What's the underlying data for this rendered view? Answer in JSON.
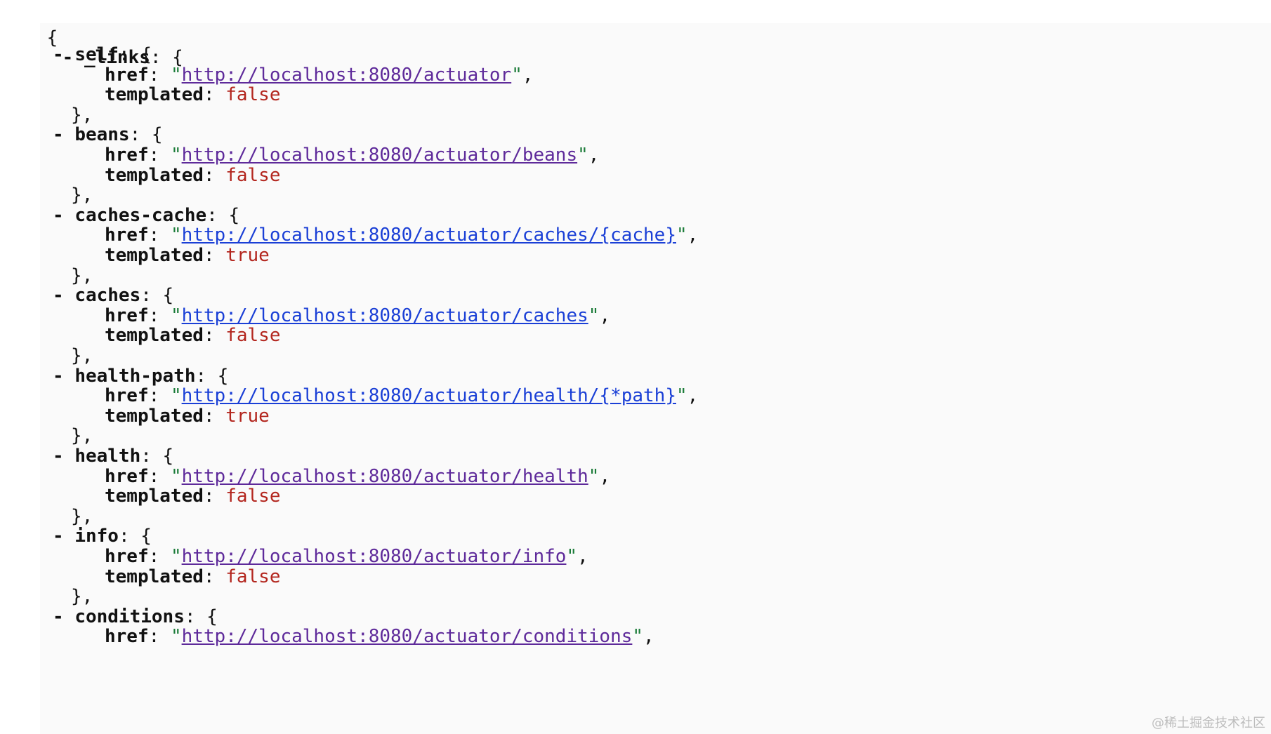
{
  "json_view": {
    "open_brace": "{",
    "root_collapse": "-",
    "root_key": "_links",
    "entries": [
      {
        "name": "self",
        "href": "http://localhost:8080/actuator",
        "templated": "false"
      },
      {
        "name": "beans",
        "href": "http://localhost:8080/actuator/beans",
        "templated": "false"
      },
      {
        "name": "caches-cache",
        "href": "http://localhost:8080/actuator/caches/{cache}",
        "templated": "true"
      },
      {
        "name": "caches",
        "href": "http://localhost:8080/actuator/caches",
        "templated": "false"
      },
      {
        "name": "health-path",
        "href": "http://localhost:8080/actuator/health/{*path}",
        "templated": "true"
      },
      {
        "name": "health",
        "href": "http://localhost:8080/actuator/health",
        "templated": "false"
      },
      {
        "name": "info",
        "href": "http://localhost:8080/actuator/info",
        "templated": "false"
      },
      {
        "name": "conditions",
        "href": "http://localhost:8080/actuator/conditions",
        "templated": ""
      }
    ],
    "labels": {
      "collapse": "-",
      "href": "href",
      "templated": "templated",
      "close": "},"
    }
  },
  "colors": {
    "visited_link": "#5e2a9a",
    "unvisited_link": "#1a3fd6",
    "boolean": "#b3261e",
    "string_quote": "#1c7c3a"
  },
  "watermark": "@稀土掘金技术社区"
}
